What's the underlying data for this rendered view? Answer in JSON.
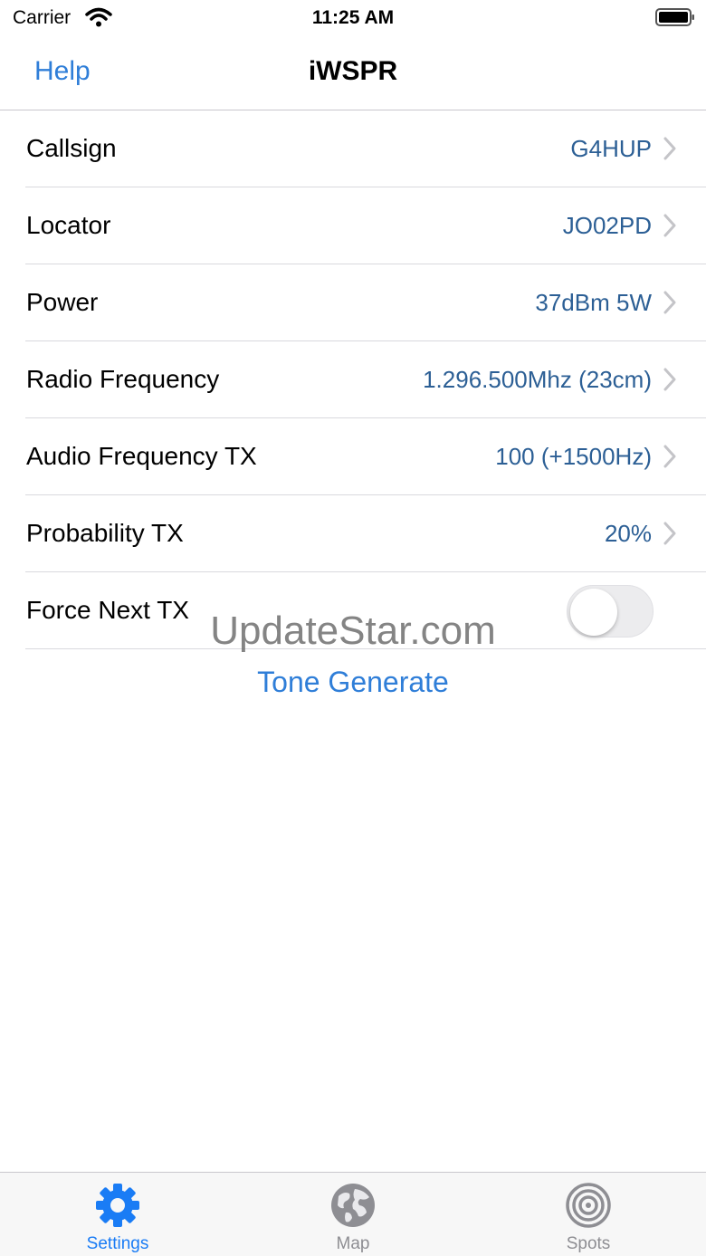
{
  "status_bar": {
    "carrier": "Carrier",
    "time": "11:25 AM"
  },
  "nav": {
    "left_button": "Help",
    "title": "iWSPR"
  },
  "settings": [
    {
      "label": "Callsign",
      "value": "G4HUP"
    },
    {
      "label": "Locator",
      "value": "JO02PD"
    },
    {
      "label": "Power",
      "value": "37dBm 5W"
    },
    {
      "label": "Radio Frequency",
      "value": "1.296.500Mhz (23cm)"
    },
    {
      "label": "Audio Frequency TX",
      "value": "100 (+1500Hz)"
    },
    {
      "label": "Probability TX",
      "value": "20%"
    }
  ],
  "force_next_tx": {
    "label": "Force Next TX",
    "on": false
  },
  "tone_button": "Tone Generate",
  "watermark": "UpdateStar.com",
  "tabs": [
    {
      "label": "Settings",
      "icon": "gear-icon",
      "active": true
    },
    {
      "label": "Map",
      "icon": "globe-icon",
      "active": false
    },
    {
      "label": "Spots",
      "icon": "target-icon",
      "active": false
    }
  ],
  "colors": {
    "accent": "#1a7cf5",
    "value_text": "#2c5f95",
    "inactive_tab": "#8e8e93"
  }
}
